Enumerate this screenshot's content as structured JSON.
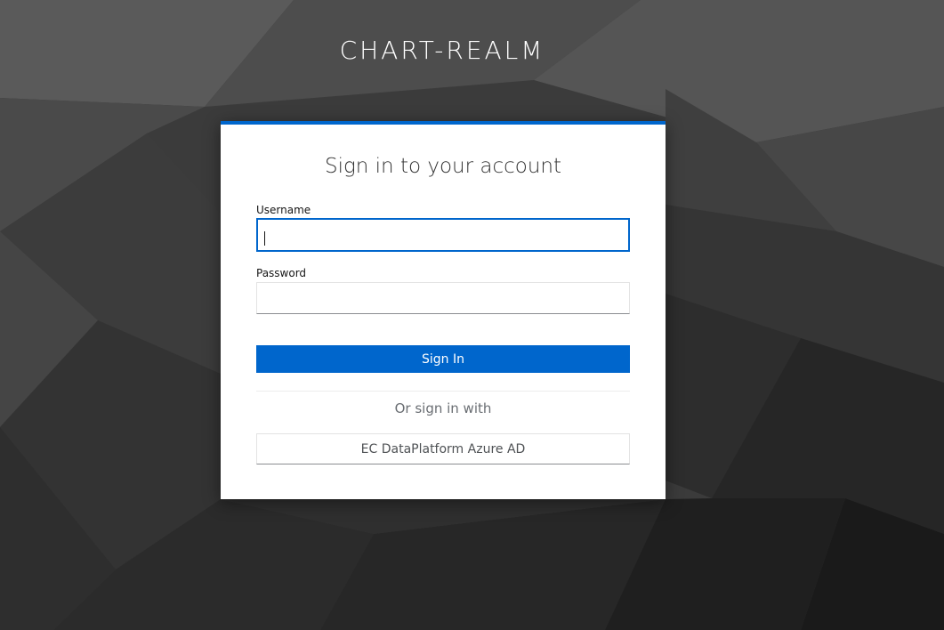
{
  "realm": {
    "title": "CHART-REALM"
  },
  "login": {
    "heading": "Sign in to your account",
    "username_label": "Username",
    "username_value": "",
    "password_label": "Password",
    "password_value": "",
    "submit_label": "Sign In",
    "alt_signin_text": "Or sign in with",
    "providers": [
      {
        "label": "EC DataPlatform Azure AD"
      }
    ]
  },
  "colors": {
    "accent": "#0066cc",
    "background": "#3a3a3a",
    "card": "#ffffff"
  }
}
